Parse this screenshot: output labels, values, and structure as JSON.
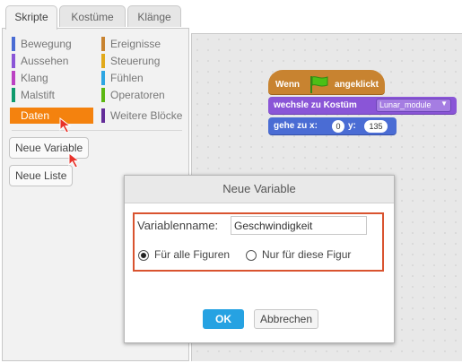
{
  "tabs": [
    {
      "label": "Skripte",
      "active": true
    },
    {
      "label": "Kostüme",
      "active": false
    },
    {
      "label": "Klänge",
      "active": false
    }
  ],
  "palette": {
    "categories": [
      {
        "label": "Bewegung",
        "color": "#4a6cd4"
      },
      {
        "label": "Ereignisse",
        "color": "#c88330"
      },
      {
        "label": "Aussehen",
        "color": "#8a55d7"
      },
      {
        "label": "Steuerung",
        "color": "#e1a91a"
      },
      {
        "label": "Klang",
        "color": "#bb42c3"
      },
      {
        "label": "Fühlen",
        "color": "#2ca5e2"
      },
      {
        "label": "Malstift",
        "color": "#0e9a6c"
      },
      {
        "label": "Operatoren",
        "color": "#5cb712"
      },
      {
        "label": "Daten",
        "color": "#ee7d16",
        "selected": true
      },
      {
        "label": "Weitere Blöcke",
        "color": "#632d99"
      }
    ],
    "new_variable_label": "Neue Variable",
    "new_list_label": "Neue Liste"
  },
  "scripts": {
    "hat": {
      "prefix": "Wenn",
      "suffix": "angeklickt",
      "flag_icon": "green-flag-icon"
    },
    "switch_costume": {
      "text": "wechsle zu Kostüm",
      "value": "Lunar_module"
    },
    "goto": {
      "text": "gehe zu x:",
      "x": "0",
      "y_label": "y:",
      "y": "135"
    }
  },
  "dialog": {
    "title": "Neue Variable",
    "name_label": "Variablenname:",
    "name_value": "Geschwindigkeit",
    "option_all": "Für alle Figuren",
    "option_this": "Nur für diese Figur",
    "ok_label": "OK",
    "cancel_label": "Abbrechen"
  },
  "colors": {
    "accent": "#26a2e2",
    "highlight": "#d9532f",
    "pointer": "#e8322a"
  }
}
